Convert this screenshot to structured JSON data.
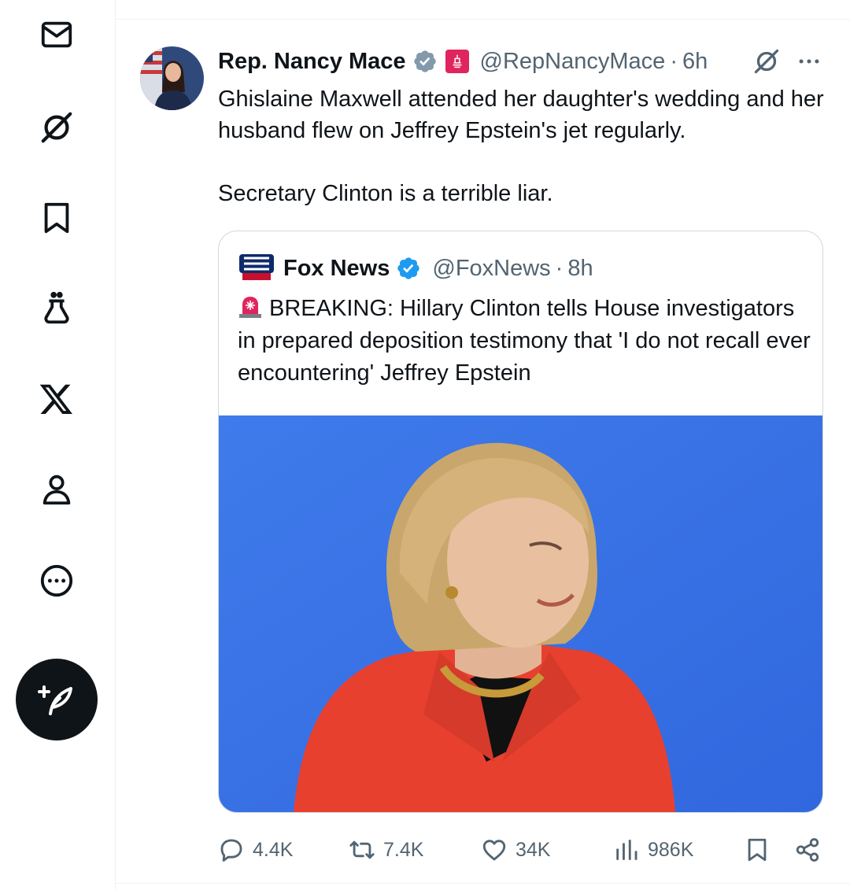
{
  "sidebar": {
    "items": [
      {
        "name": "messages",
        "icon": "mail-icon"
      },
      {
        "name": "grok",
        "icon": "grok-icon"
      },
      {
        "name": "bookmarks",
        "icon": "bookmark-icon"
      },
      {
        "name": "labs",
        "icon": "flask-icon"
      },
      {
        "name": "premium",
        "icon": "x-logo-icon"
      },
      {
        "name": "profile",
        "icon": "person-icon"
      },
      {
        "name": "more",
        "icon": "more-circle-icon"
      }
    ],
    "compose_icon": "compose-quill-icon"
  },
  "post": {
    "author_name": "Rep. Nancy Mace",
    "verified": "grey-check-badge",
    "affiliation_badge": "house-seal-badge",
    "handle": "@RepNancyMace",
    "separator": "·",
    "time": "6h",
    "text": "Ghislaine Maxwell attended her daughter's wedding and her husband flew on Jeffrey Epstein's jet regularly.\n\nSecretary Clinton is a terrible liar.",
    "quote": {
      "author_name": "Fox News",
      "verified": "blue-check-badge",
      "handle": "@FoxNews",
      "separator": "·",
      "time": "8h",
      "text": "BREAKING: Hillary Clinton tells House investigators in prepared deposition testimony that 'I do not recall ever encountering' Jeffrey Epstein",
      "image_alt": "woman in red jacket against blue background"
    },
    "actions": {
      "replies": "4.4K",
      "reposts": "7.4K",
      "likes": "34K",
      "views": "986K"
    }
  },
  "colors": {
    "text_primary": "#0f1419",
    "text_secondary": "#536471",
    "verified_blue": "#1d9bf0",
    "border": "#cfd9de",
    "image_bg": "#3a74e6",
    "jacket": "#e8402f"
  }
}
